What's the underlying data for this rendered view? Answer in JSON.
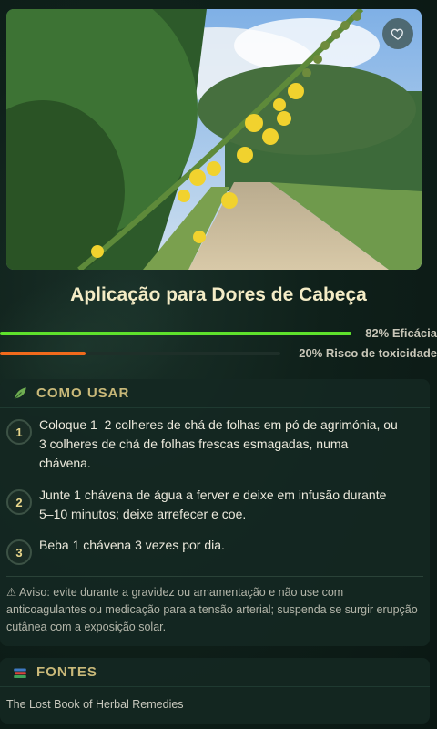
{
  "title": "Aplicação para Dores de Cabeça",
  "metrics": {
    "efficacy": {
      "label": "82% Eficácia",
      "percent": 82,
      "color": "#5ee12c"
    },
    "toxicity": {
      "label": "20% Risco de toxicidade",
      "percent": 20,
      "color": "#f06a1c"
    }
  },
  "how_to_use": {
    "heading": "COMO USAR",
    "steps": [
      {
        "n": "1",
        "text": "Coloque 1–2 colheres de chá de folhas em pó de agrimónia, ou 3 colheres de chá de folhas frescas esmagadas, numa chávena."
      },
      {
        "n": "2",
        "text": "Junte 1 chávena de água a ferver e deixe em infusão durante 5–10 minutos; deixe arrefecer e coe."
      },
      {
        "n": "3",
        "text": "Beba 1 chávena 3 vezes por dia."
      }
    ],
    "warning": "⚠ Aviso: evite durante a gravidez ou amamentação e não use com anticoagulantes ou medicação para a tensão arterial; suspenda se surgir erupção cutânea com a exposição solar."
  },
  "sources": {
    "heading": "FONTES",
    "items": [
      "The Lost Book of Herbal Remedies"
    ]
  }
}
